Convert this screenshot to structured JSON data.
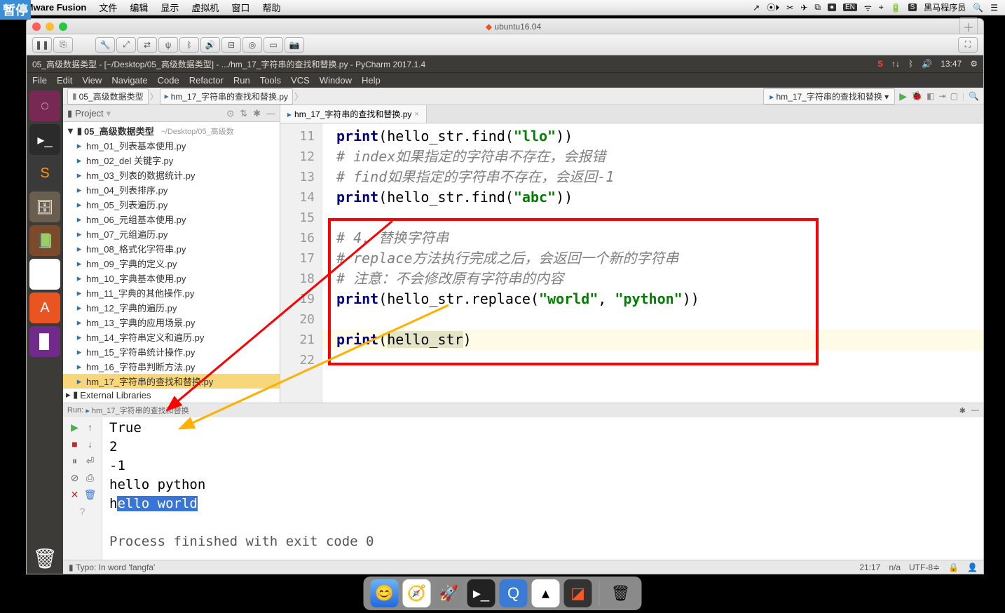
{
  "mac_menubar": {
    "apple": "",
    "app": "VMware Fusion",
    "menus": [
      "文件",
      "编辑",
      "显示",
      "虚拟机",
      "窗口",
      "帮助"
    ],
    "user": "黑马程序员"
  },
  "vm": {
    "title": "ubuntu16.04",
    "toolbar_icons": [
      "wrench",
      "back",
      "fwd",
      "network",
      "usb",
      "audio",
      "display",
      "dvd",
      "hd",
      "camera"
    ]
  },
  "ubuntu": {
    "window_title": "05_高级数据类型 - [~/Desktop/05_高级数据类型] - .../hm_17_字符串的查找和替换.py - PyCharm 2017.1.4",
    "menus": [
      "File",
      "Edit",
      "View",
      "Navigate",
      "Code",
      "Refactor",
      "Run",
      "Tools",
      "VCS",
      "Window",
      "Help"
    ],
    "time": "13:47"
  },
  "pycharm": {
    "breadcrumbs": [
      "05_高级数据类型",
      "hm_17_字符串的查找和替换.py"
    ],
    "run_config": "hm_17_字符串的查找和替换",
    "project_label": "Project",
    "project_root": "05_高级数据类型",
    "project_root_path": "~/Desktop/05_高级数",
    "files": [
      "hm_01_列表基本使用.py",
      "hm_02_del 关键字.py",
      "hm_03_列表的数据统计.py",
      "hm_04_列表排序.py",
      "hm_05_列表遍历.py",
      "hm_06_元组基本使用.py",
      "hm_07_元组遍历.py",
      "hm_08_格式化字符串.py",
      "hm_09_字典的定义.py",
      "hm_10_字典基本使用.py",
      "hm_11_字典的其他操作.py",
      "hm_12_字典的遍历.py",
      "hm_13_字典的应用场景.py",
      "hm_14_字符串定义和遍历.py",
      "hm_15_字符串统计操作.py",
      "hm_16_字符串判断方法.py",
      "hm_17_字符串的查找和替换.py"
    ],
    "external_libs": "External Libraries",
    "tab_name": "hm_17_字符串的查找和替换.py",
    "code_lines": {
      "11": {
        "type": "code",
        "tokens": [
          {
            "t": "kw",
            "v": "print"
          },
          {
            "t": "",
            "v": "(hello_str.find("
          },
          {
            "t": "str",
            "v": "\"llo\""
          },
          {
            "t": "",
            "v": "))"
          }
        ]
      },
      "12": {
        "type": "cmt",
        "v": "# index如果指定的字符串不存在，会报错"
      },
      "13": {
        "type": "cmt",
        "v": "# find如果指定的字符串不存在，会返回-1"
      },
      "14": {
        "type": "code",
        "tokens": [
          {
            "t": "kw",
            "v": "print"
          },
          {
            "t": "",
            "v": "(hello_str.find("
          },
          {
            "t": "str",
            "v": "\"abc\""
          },
          {
            "t": "",
            "v": "))"
          }
        ]
      },
      "15": {
        "type": "blank"
      },
      "16": {
        "type": "cmt",
        "v": "# 4. 替换字符串"
      },
      "17": {
        "type": "cmt",
        "v": "# replace方法执行完成之后，会返回一个新的字符串"
      },
      "18": {
        "type": "cmt",
        "v": "# 注意：不会修改原有字符串的内容"
      },
      "19": {
        "type": "code",
        "tokens": [
          {
            "t": "kw",
            "v": "print"
          },
          {
            "t": "",
            "v": "(hello_str.replace("
          },
          {
            "t": "str",
            "v": "\"world\""
          },
          {
            "t": "",
            "v": ", "
          },
          {
            "t": "str",
            "v": "\"python\""
          },
          {
            "t": "",
            "v": "))"
          }
        ]
      },
      "20": {
        "type": "blank"
      },
      "21": {
        "type": "code",
        "cursor": true,
        "tokens": [
          {
            "t": "kw",
            "v": "print"
          },
          {
            "t": "",
            "v": "("
          },
          {
            "t": "hl",
            "v": "hello_str"
          },
          {
            "t": "",
            "v": ")"
          }
        ]
      },
      "22": {
        "type": "blank"
      }
    },
    "run_tab": "Run:",
    "run_config_name": "hm_17_字符串的查找和替换",
    "output": {
      "lines": [
        "True",
        "2",
        "-1",
        "hello python"
      ],
      "partial": {
        "pre": "h",
        "sel": "ello world"
      },
      "process": "Process finished with exit code 0"
    },
    "statusbar": {
      "left": "Typo: In word 'fangfa'",
      "pos": "21:17",
      "na": "n/a",
      "enc": "UTF-8"
    }
  },
  "pause_label": "暂停"
}
